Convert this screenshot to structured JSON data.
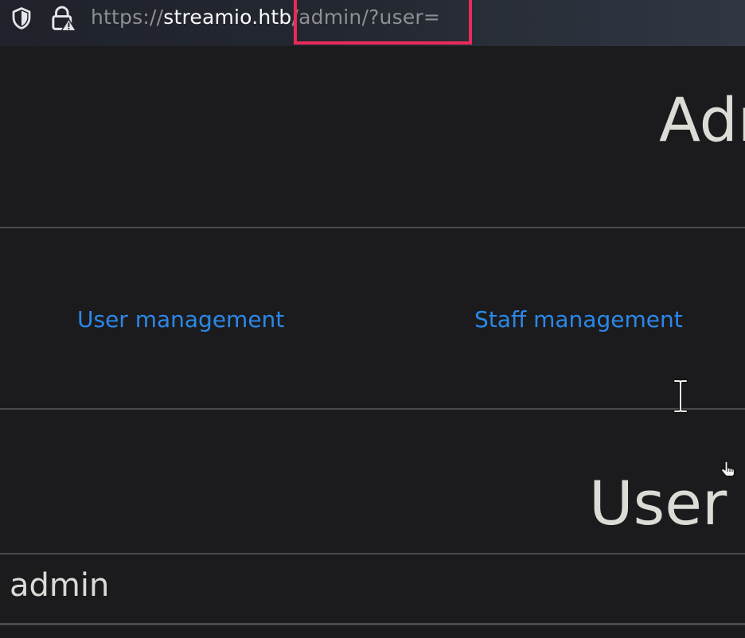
{
  "browser": {
    "url_scheme": "https://",
    "url_host": "streamio.htb",
    "url_path": "/admin/?user=",
    "icons": [
      "shield-icon",
      "lock-warning-icon"
    ],
    "highlight_color": "#ea2a5a"
  },
  "page": {
    "title": "Adr",
    "nav": {
      "user_management": "User management",
      "staff_management": "Staff management"
    },
    "section_title": "User",
    "rows": [
      "admin"
    ],
    "link_color": "#2b88e8"
  }
}
